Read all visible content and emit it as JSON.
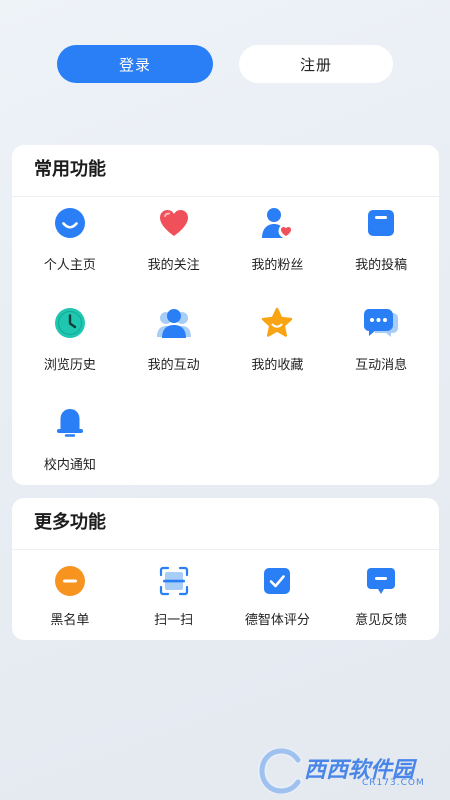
{
  "auth": {
    "login_label": "登录",
    "register_label": "注册"
  },
  "common": {
    "title": "常用功能",
    "items": [
      {
        "label": "个人主页",
        "icon": "smile-face-icon"
      },
      {
        "label": "我的关注",
        "icon": "heart-icon"
      },
      {
        "label": "我的粉丝",
        "icon": "user-heart-icon"
      },
      {
        "label": "我的投稿",
        "icon": "document-square-icon"
      },
      {
        "label": "浏览历史",
        "icon": "clock-icon"
      },
      {
        "label": "我的互动",
        "icon": "users-icon"
      },
      {
        "label": "我的收藏",
        "icon": "star-icon"
      },
      {
        "label": "互动消息",
        "icon": "chat-bubbles-icon"
      },
      {
        "label": "校内通知",
        "icon": "bell-icon"
      }
    ]
  },
  "more": {
    "title": "更多功能",
    "items": [
      {
        "label": "黑名单",
        "icon": "minus-circle-icon"
      },
      {
        "label": "扫一扫",
        "icon": "scan-icon"
      },
      {
        "label": "德智体评分",
        "icon": "checkbox-icon"
      },
      {
        "label": "意见反馈",
        "icon": "feedback-bubble-icon"
      }
    ]
  },
  "colors": {
    "primary": "#2a7ef6",
    "heart": "#f0505a",
    "teal": "#1fc7b0",
    "star": "#f8a414",
    "orange": "#f79420"
  },
  "watermark": {
    "brand": "西西软件园",
    "sub": "CR173.COM"
  }
}
